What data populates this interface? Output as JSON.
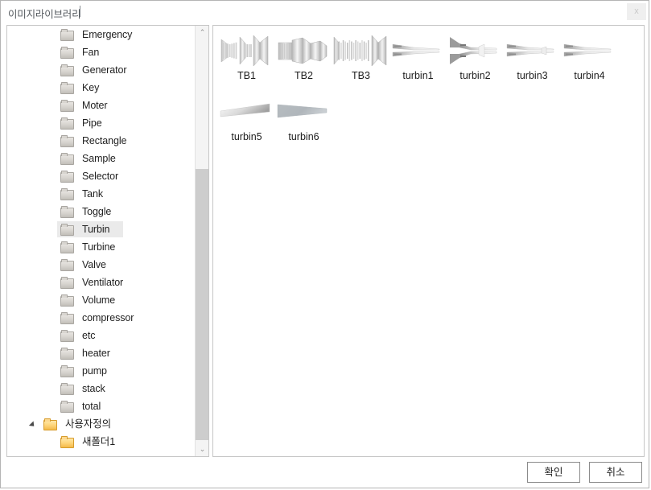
{
  "window": {
    "title": "이미지라이브러리",
    "close_label": "x"
  },
  "tree": {
    "scrollbar": {
      "up_arrow": "⌃",
      "down_arrow": "⌄"
    },
    "items": [
      {
        "label": "Emergency",
        "level": 2,
        "folder": "gray",
        "expander": false,
        "selected": false
      },
      {
        "label": "Fan",
        "level": 2,
        "folder": "gray",
        "expander": false,
        "selected": false
      },
      {
        "label": "Generator",
        "level": 2,
        "folder": "gray",
        "expander": false,
        "selected": false
      },
      {
        "label": "Key",
        "level": 2,
        "folder": "gray",
        "expander": false,
        "selected": false
      },
      {
        "label": "Moter",
        "level": 2,
        "folder": "gray",
        "expander": false,
        "selected": false
      },
      {
        "label": "Pipe",
        "level": 2,
        "folder": "gray",
        "expander": false,
        "selected": false
      },
      {
        "label": "Rectangle",
        "level": 2,
        "folder": "gray",
        "expander": false,
        "selected": false
      },
      {
        "label": "Sample",
        "level": 2,
        "folder": "gray",
        "expander": false,
        "selected": false
      },
      {
        "label": "Selector",
        "level": 2,
        "folder": "gray",
        "expander": false,
        "selected": false
      },
      {
        "label": "Tank",
        "level": 2,
        "folder": "gray",
        "expander": false,
        "selected": false
      },
      {
        "label": "Toggle",
        "level": 2,
        "folder": "gray",
        "expander": false,
        "selected": false
      },
      {
        "label": "Turbin",
        "level": 2,
        "folder": "gray",
        "expander": false,
        "selected": true
      },
      {
        "label": "Turbine",
        "level": 2,
        "folder": "gray",
        "expander": false,
        "selected": false
      },
      {
        "label": "Valve",
        "level": 2,
        "folder": "gray",
        "expander": false,
        "selected": false
      },
      {
        "label": "Ventilator",
        "level": 2,
        "folder": "gray",
        "expander": false,
        "selected": false
      },
      {
        "label": "Volume",
        "level": 2,
        "folder": "gray",
        "expander": false,
        "selected": false
      },
      {
        "label": "compressor",
        "level": 2,
        "folder": "gray",
        "expander": false,
        "selected": false
      },
      {
        "label": "etc",
        "level": 2,
        "folder": "gray",
        "expander": false,
        "selected": false
      },
      {
        "label": "heater",
        "level": 2,
        "folder": "gray",
        "expander": false,
        "selected": false
      },
      {
        "label": "pump",
        "level": 2,
        "folder": "gray",
        "expander": false,
        "selected": false
      },
      {
        "label": "stack",
        "level": 2,
        "folder": "gray",
        "expander": false,
        "selected": false
      },
      {
        "label": "total",
        "level": 2,
        "folder": "gray",
        "expander": false,
        "selected": false
      },
      {
        "label": "사용자정의",
        "level": 1,
        "folder": "orange",
        "expander": true,
        "selected": false
      },
      {
        "label": "새폴더1",
        "level": 2,
        "folder": "orange",
        "expander": false,
        "selected": false
      }
    ]
  },
  "content": {
    "thumbnails": [
      {
        "label": "TB1",
        "shape": "tb1"
      },
      {
        "label": "TB2",
        "shape": "tb2"
      },
      {
        "label": "TB3",
        "shape": "tb3"
      },
      {
        "label": "turbin1",
        "shape": "turbin1"
      },
      {
        "label": "turbin2",
        "shape": "turbin2"
      },
      {
        "label": "turbin3",
        "shape": "turbin3"
      },
      {
        "label": "turbin4",
        "shape": "turbin4"
      },
      {
        "label": "turbin5",
        "shape": "turbin5"
      },
      {
        "label": "turbin6",
        "shape": "turbin6"
      }
    ]
  },
  "footer": {
    "ok_label": "확인",
    "cancel_label": "취소"
  },
  "colors": {
    "window_border": "#b4b4b4",
    "panel_border": "#c6c6c6",
    "selection": "#eaeaea",
    "scroll_thumb": "#cdcdcd",
    "scroll_track": "#f4f4f4",
    "title_text": "#555a5f",
    "folder_orange": "#f3b949",
    "folder_gray": "#d6d3ce"
  }
}
